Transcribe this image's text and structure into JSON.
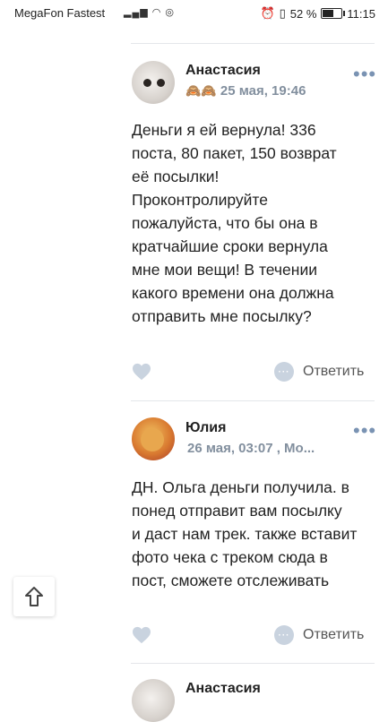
{
  "status_bar": {
    "carrier": "MegaFon Fastest",
    "battery_percent": "52 %",
    "battery_level": 0.52,
    "time": "11:15"
  },
  "comments": [
    {
      "author": "Анастасия",
      "emoji": "🙈🙈",
      "date": "25 мая, 19:46",
      "text_lines": [
        "Деньги я ей вернула! 336",
        "поста, 80 пакет, 150 возврат",
        "её посылки!",
        "Проконтролируйте",
        "пожалуйста, что бы она в",
        "кратчайшие сроки вернула",
        "мне мои вещи! В течении",
        "какого времени она должна",
        "отправить мне посылку?"
      ],
      "reply_label": "Ответить"
    },
    {
      "author": "Юлия",
      "date": "26 мая, 03:07 , Мо...",
      "text_lines": [
        "ДН. Ольга деньги получила. в",
        "понед отправит вам посылку",
        "и даст нам трек. также вставит",
        "фото чека с треком сюда в",
        "пост, сможете отслеживать"
      ],
      "reply_label": "Ответить"
    },
    {
      "author": "Анастасия"
    }
  ],
  "icons": {
    "more": "more-dots-icon",
    "like": "heart-icon",
    "reply": "comment-bubble-icon",
    "scroll_up": "scroll-up-arrow-icon"
  },
  "colors": {
    "meta": "#828f9e",
    "accent": "#7a93b3",
    "like": "#c9d3df"
  }
}
